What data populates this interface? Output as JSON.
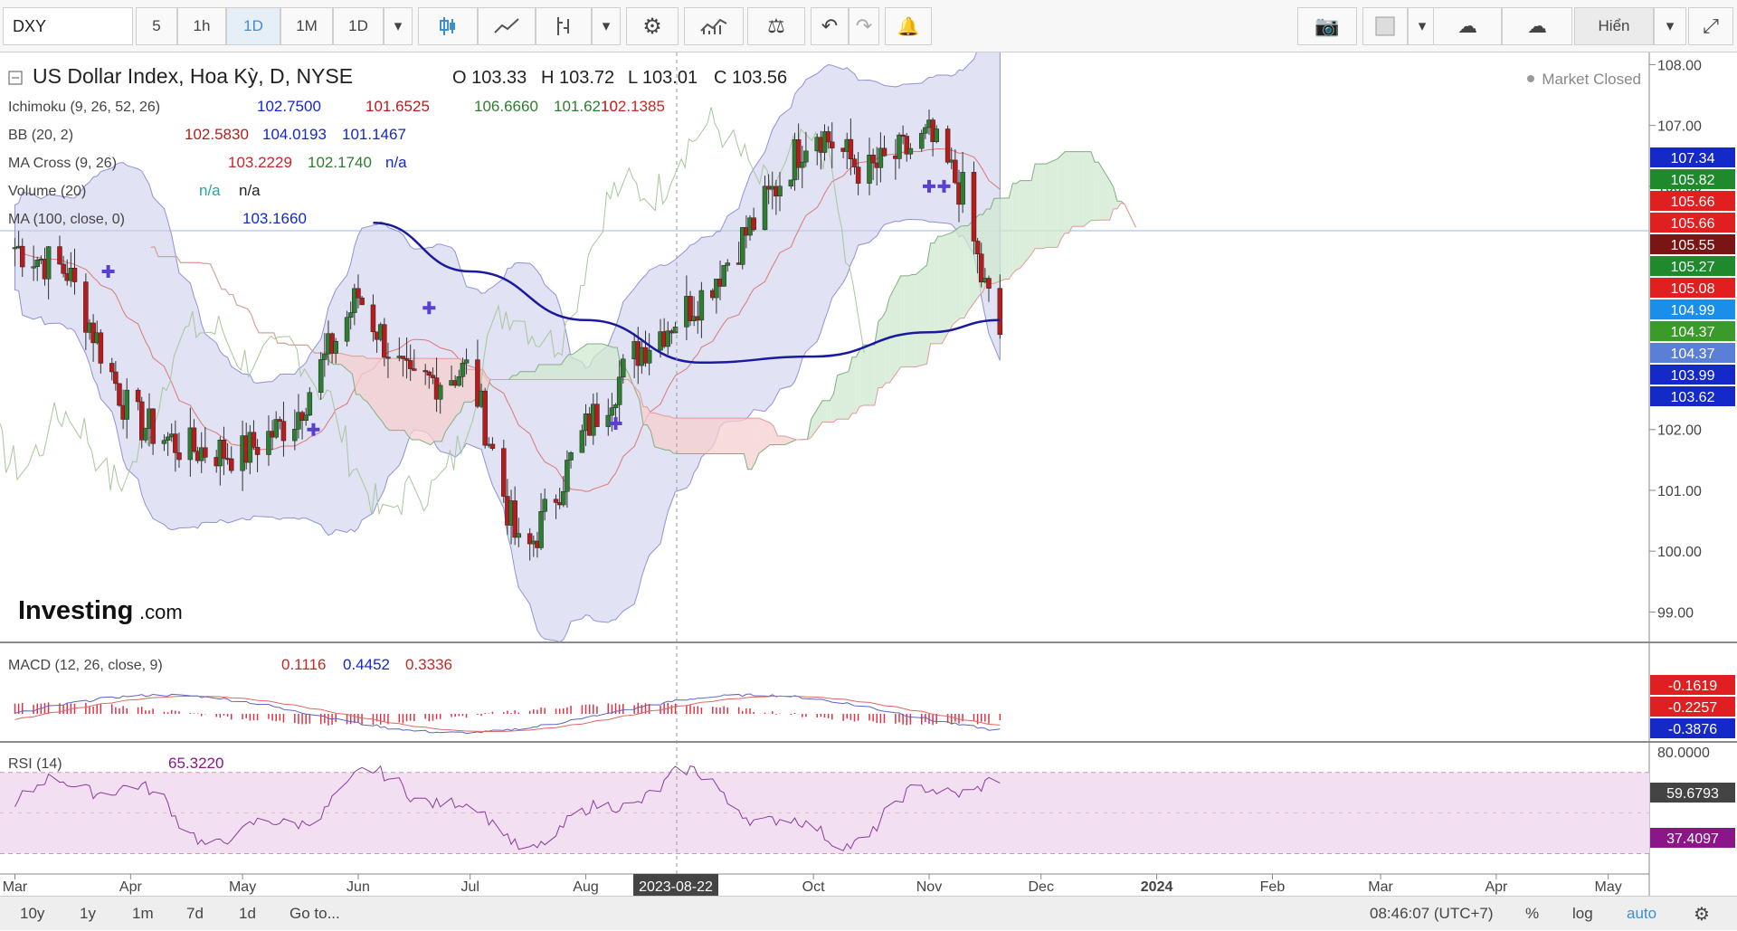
{
  "toolbar": {
    "symbol": "DXY",
    "intervals": [
      "5",
      "1h",
      "1D",
      "1M",
      "1D"
    ],
    "active_interval": "1D",
    "hide_label": "Hiển",
    "colors": {
      "active": "#3b8fd5",
      "up": "#2e7d32",
      "down": "#c62828"
    }
  },
  "header": {
    "title": "US Dollar Index, Hoa Kỳ, D, NYSE",
    "ohlc": {
      "o": "O 103.33",
      "h": "H 103.72",
      "l": "L 103.01",
      "c": "C 103.56"
    },
    "status": "Market Closed",
    "logo_text": "Investing",
    "logo_suffix": ".com"
  },
  "indicators": {
    "ichimoku": {
      "name": "Ichimoku (9, 26, 52, 26)",
      "values": [
        "102.7500",
        "101.6525",
        "106.6660",
        "101.6210",
        "102.1385"
      ]
    },
    "bb": {
      "name": "BB (20, 2)",
      "values": [
        "102.5830",
        "104.0193",
        "101.1467"
      ]
    },
    "macross": {
      "name": "MA Cross (9, 26)",
      "values": [
        "103.2229",
        "102.1740",
        "n/a"
      ]
    },
    "volume": {
      "name": "Volume (20)",
      "values": [
        "n/a",
        "n/a"
      ]
    },
    "ma": {
      "name": "MA (100, close, 0)",
      "values": [
        "103.1660"
      ]
    },
    "macd": {
      "name": "MACD (12, 26, close, 9)",
      "values": [
        "0.1116",
        "0.4452",
        "0.3336"
      ]
    },
    "rsi": {
      "name": "RSI (14)",
      "values": [
        "65.3220"
      ]
    }
  },
  "price_axis": {
    "ticks": [
      "108.00",
      "107.00",
      "106.00",
      "102.00",
      "101.00",
      "100.00",
      "99.00"
    ],
    "tags": [
      {
        "v": "107.34",
        "c": "#1528c8"
      },
      {
        "v": "105.82",
        "c": "#1e8a2c"
      },
      {
        "v": "105.66",
        "c": "#e02020"
      },
      {
        "v": "105.66",
        "c": "#e02020"
      },
      {
        "v": "105.55",
        "c": "#7a1515"
      },
      {
        "v": "105.27",
        "c": "#1e8a2c"
      },
      {
        "v": "105.08",
        "c": "#e02020"
      },
      {
        "v": "104.99",
        "c": "#1a8ee8"
      },
      {
        "v": "104.37",
        "c": "#3a9a2a"
      },
      {
        "v": "104.37",
        "c": "#5b7fd6"
      },
      {
        "v": "103.99",
        "c": "#1528c8"
      },
      {
        "v": "103.62",
        "c": "#1528c8"
      }
    ]
  },
  "macd_axis": {
    "tags": [
      {
        "v": "-0.1619",
        "c": "#e02020"
      },
      {
        "v": "-0.2257",
        "c": "#e02020"
      },
      {
        "v": "-0.3876",
        "c": "#1528c8"
      }
    ]
  },
  "rsi_axis": {
    "ticks": [
      "80.0000"
    ],
    "tags": [
      {
        "v": "59.6793",
        "c": "#444444"
      },
      {
        "v": "37.4097",
        "c": "#8a168a"
      }
    ]
  },
  "time_axis": {
    "labels": [
      "Mar",
      "Apr",
      "May",
      "Jun",
      "Jul",
      "Aug",
      "Sep",
      "Oct",
      "Nov",
      "Dec",
      "2024",
      "Feb",
      "Mar",
      "Apr",
      "May"
    ],
    "cursor_label": "2023-08-22"
  },
  "bottom": {
    "ranges": [
      "10y",
      "1y",
      "1m",
      "7d",
      "1d"
    ],
    "goto": "Go to...",
    "clock": "08:46:07 (UTC+7)",
    "pct": "%",
    "log": "log",
    "auto": "auto"
  },
  "chart_data": {
    "type": "line",
    "title": "US Dollar Index, Hoa Kỳ, D, NYSE",
    "ylim": [
      98.5,
      108.2
    ],
    "series": [
      {
        "name": "US Dollar Index",
        "x": [
          "2023-03-01",
          "2023-03-15",
          "2023-04-01",
          "2023-04-15",
          "2023-05-01",
          "2023-05-15",
          "2023-06-01",
          "2023-06-15",
          "2023-07-01",
          "2023-07-15",
          "2023-08-01",
          "2023-08-15",
          "2023-09-01",
          "2023-09-15",
          "2023-10-01",
          "2023-10-15",
          "2023-11-01",
          "2023-11-10",
          "2023-11-15",
          "2023-11-20"
        ],
        "values": [
          105.0,
          104.6,
          102.2,
          101.7,
          101.6,
          102.2,
          104.2,
          102.7,
          103.0,
          99.8,
          102.0,
          103.3,
          104.2,
          105.4,
          107.0,
          106.2,
          106.8,
          105.9,
          104.5,
          103.56
        ]
      },
      {
        "name": "MA (100, close, 0)",
        "x": [
          "2023-06-05",
          "2023-07-01",
          "2023-08-01",
          "2023-09-01",
          "2023-10-01",
          "2023-11-01",
          "2023-11-20"
        ],
        "values": [
          105.4,
          104.6,
          103.8,
          103.1,
          103.2,
          103.6,
          103.8
        ]
      }
    ],
    "macd": {
      "ylim": [
        -1,
        1
      ]
    },
    "rsi": {
      "ylim": [
        20,
        85
      ],
      "levels": [
        70,
        30
      ]
    }
  }
}
